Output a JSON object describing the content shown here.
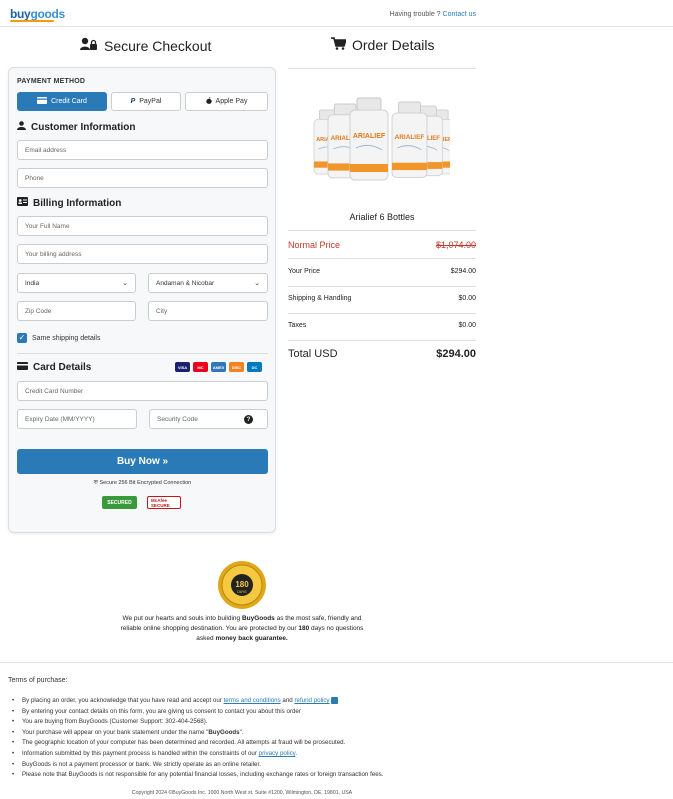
{
  "header": {
    "logo_part1": "buy",
    "logo_part2": "goods",
    "trouble_text": "Having trouble ?",
    "contact_link": "Contact us"
  },
  "checkout": {
    "title": "Secure Checkout",
    "payment_method_label": "PAYMENT METHOD",
    "payment_options": [
      {
        "label": "Credit Card",
        "icon": "credit-card-icon",
        "active": true
      },
      {
        "label": "PayPal",
        "icon": "paypal-icon",
        "active": false
      },
      {
        "label": "Apple Pay",
        "icon": "apple-icon",
        "active": false
      }
    ],
    "customer_info_title": "Customer Information",
    "email_placeholder": "Email address",
    "phone_placeholder": "Phone",
    "billing_info_title": "Billing Information",
    "fullname_placeholder": "Your Full Name",
    "address_placeholder": "Your billing address",
    "country_value": "India",
    "state_value": "Andaman & Nicobar",
    "zip_placeholder": "Zip Code",
    "city_placeholder": "City",
    "same_shipping_label": "Same shipping details",
    "card_details_title": "Card Details",
    "card_brands": [
      "VISA",
      "MC",
      "AMEX",
      "DISC",
      "DC"
    ],
    "card_number_placeholder": "Credit Card Number",
    "expiry_placeholder": "Expiry Date (MM/YYYY)",
    "security_placeholder": "Security Code",
    "buy_button": "Buy Now »",
    "secure_note": "Secure 256 Bit Encrypted Connection",
    "badge_secured": "SECURED",
    "badge_mcafee": "McAfee SECURE"
  },
  "order": {
    "title": "Order Details",
    "product_name": "Arialief 6 Bottles",
    "bottle_label": "ARIALIEF",
    "normal_price_label": "Normal Price",
    "normal_price_value": "$1,074.00",
    "your_price_label": "Your Price",
    "your_price_value": "$294.00",
    "shipping_label": "Shipping & Handling",
    "shipping_value": "$0.00",
    "taxes_label": "Taxes",
    "taxes_value": "$0.00",
    "total_label": "Total USD",
    "total_value": "$294.00"
  },
  "guarantee": {
    "seal_text": "180 DAYS MONEY BACK GUARANTEE",
    "text_1": "We put our hearts and souls into building ",
    "brand": "BuyGoods",
    "text_2": " as the most safe, friendly and reliable online shopping destination. You are protected by our ",
    "days": "180",
    "text_3": " days no questions asked ",
    "bold_end": "money back guarantee."
  },
  "terms": {
    "title": "Terms of purchase:",
    "item1_a": "By placing an order, you acknowledge that you have read and accept our ",
    "item1_link1": "terms and conditions",
    "item1_and": " and ",
    "item1_link2": "refund policy",
    "item2": "By entering your contact details on this form, you are giving us consent to contact you about this order",
    "item3": "You are buying from BuyGoods (Customer Support: 302-404-2568).",
    "item4_a": "Your purchase will appear on your bank statement under the name \"",
    "item4_b": "BuyGoods",
    "item4_c": "\".",
    "item5": "The geographic location of your computer has been determined and recorded. All attempts at fraud will be prosecuted.",
    "item6_a": "Information submitted by this payment process is handled within the constraints of our ",
    "item6_link": "privacy policy",
    "item6_b": ".",
    "item7": "BuyGoods is not a payment processor or bank. We strictly operate as an online retailer.",
    "item8": "Please note that BuyGoods is not responsible for any potential financial losses, including exchange rates or foreign transaction fees."
  },
  "footer": {
    "copyright": "Copyright 2024 ©BuyGoods Inc. 1000 North West st. Suite #1200, Wilmington, DE, 19801, USA"
  }
}
